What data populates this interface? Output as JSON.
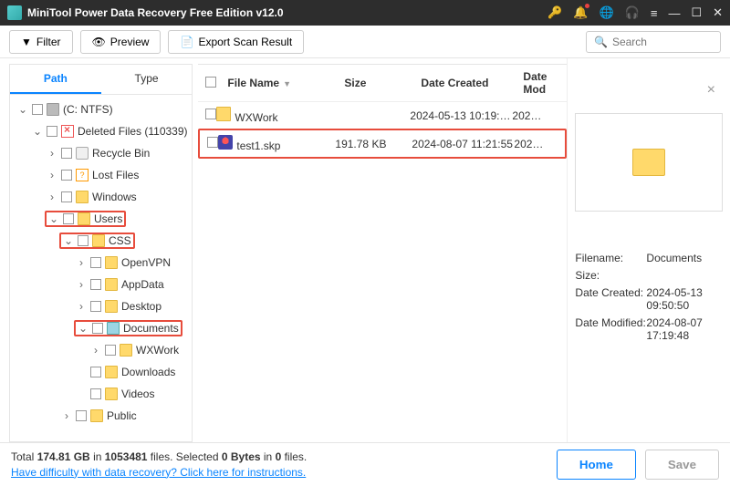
{
  "title": "MiniTool Power Data Recovery Free Edition v12.0",
  "toolbar": {
    "filter": "Filter",
    "preview": "Preview",
    "export": "Export Scan Result",
    "search_placeholder": "Search"
  },
  "tabs": {
    "path": "Path",
    "type": "Type"
  },
  "tree": {
    "root": "(C: NTFS)",
    "deleted": "Deleted Files (110339)",
    "recycle": "Recycle Bin",
    "lost": "Lost Files",
    "windows": "Windows",
    "users": "Users",
    "css": "CSS",
    "openvpn": "OpenVPN",
    "appdata": "AppData",
    "desktop": "Desktop",
    "documents": "Documents",
    "wxwork": "WXWork",
    "downloads": "Downloads",
    "videos": "Videos",
    "public": "Public"
  },
  "filetable": {
    "headers": {
      "name": "File Name",
      "size": "Size",
      "created": "Date Created",
      "mod": "Date Mod"
    },
    "rows": [
      {
        "name": "WXWork",
        "size": "",
        "created": "2024-05-13 10:19:…",
        "mod": "202…",
        "icon": "folder"
      },
      {
        "name": "test1.skp",
        "size": "191.78 KB",
        "created": "2024-08-07 11:21:55",
        "mod": "202…",
        "icon": "skp"
      }
    ]
  },
  "details": {
    "filename_label": "Filename:",
    "filename": "Documents",
    "size_label": "Size:",
    "size": "",
    "created_label": "Date Created:",
    "created": "2024-05-13 09:50:50",
    "modified_label": "Date Modified:",
    "modified": "2024-08-07 17:19:48"
  },
  "footer": {
    "stats_prefix": "Total ",
    "total_size": "174.81 GB",
    "stats_mid1": " in ",
    "total_files": "1053481",
    "stats_mid2": " files.   Selected ",
    "sel_size": "0 Bytes",
    "stats_mid3": " in ",
    "sel_files": "0",
    "stats_end": " files.",
    "help_link": "Have difficulty with data recovery? Click here for instructions.",
    "home": "Home",
    "save": "Save"
  }
}
